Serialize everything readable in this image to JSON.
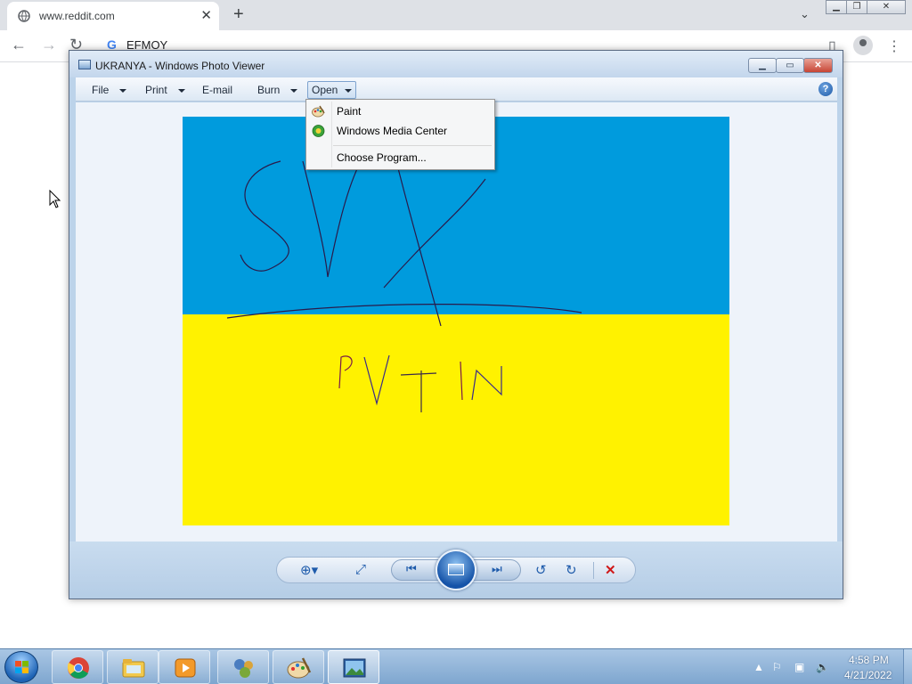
{
  "browser": {
    "tab_title": "www.reddit.com",
    "omnibox_text": "EFMOY"
  },
  "photo_viewer": {
    "window_title": "UKRANYA - Windows Photo Viewer",
    "menu": {
      "file": "File",
      "print": "Print",
      "email": "E-mail",
      "burn": "Burn",
      "open": "Open"
    },
    "open_menu_items": [
      {
        "label": "Paint",
        "icon": "paint-icon"
      },
      {
        "label": "Windows Media Center",
        "icon": "media-center-icon"
      },
      {
        "label": "Choose Program...",
        "icon": ""
      }
    ],
    "image": {
      "handwritten_top": "SVX",
      "handwritten_bottom": "PVTIN",
      "top_color": "#009bdd",
      "bottom_color": "#fff200"
    }
  },
  "taskbar": {
    "apps": [
      "chrome-icon",
      "file-explorer-icon",
      "media-player-icon",
      "control-panel-icon",
      "paint-icon",
      "photo-viewer-icon"
    ],
    "time": "4:58 PM",
    "date": "4/21/2022"
  }
}
